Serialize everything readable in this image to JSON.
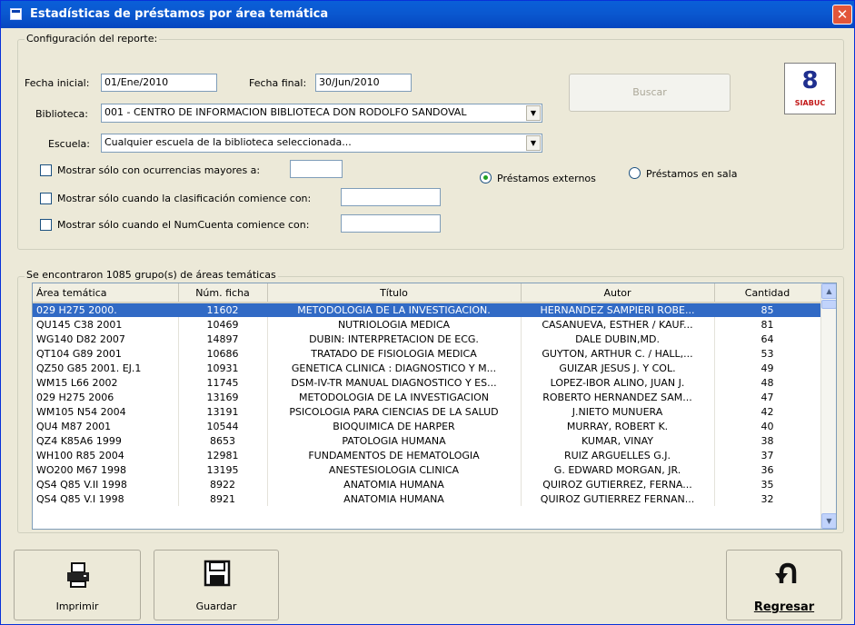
{
  "window": {
    "title": "Estadísticas de préstamos por área temática",
    "close_glyph": "✕"
  },
  "config": {
    "legend": "Configuración del reporte:",
    "fecha_inicial_label": "Fecha inicial:",
    "fecha_inicial_value": "01/Ene/2010",
    "fecha_final_label": "Fecha final:",
    "fecha_final_value": "30/Jun/2010",
    "biblioteca_label": "Biblioteca:",
    "biblioteca_value": "001 - CENTRO DE INFORMACION BIBLIOTECA DON RODOLFO SANDOVAL",
    "escuela_label": "Escuela:",
    "escuela_value": "Cualquier escuela de la biblioteca seleccionada...",
    "chk_ocurrencias_label": "Mostrar sólo con ocurrencias mayores a:",
    "chk_clasificacion_label": "Mostrar sólo cuando la clasificación comience con:",
    "chk_numcuenta_label": "Mostrar sólo cuando el NumCuenta comience con:",
    "radio_externos_label": "Préstamos externos",
    "radio_sala_label": "Préstamos en sala",
    "buscar_label": "Buscar",
    "logo_number": "8",
    "logo_text": "SIABUC"
  },
  "results": {
    "legend": "Se encontraron 1085 grupo(s) de áreas temáticas",
    "columns": [
      "Área temática",
      "Núm. ficha",
      "Título",
      "Autor",
      "Cantidad"
    ],
    "rows": [
      [
        "029 H275 2000.",
        "11602",
        "METODOLOGIA DE LA INVESTIGACION.",
        "HERNANDEZ SAMPIERI ROBE...",
        "85"
      ],
      [
        "QU145 C38 2001",
        "10469",
        "NUTRIOLOGIA MEDICA",
        "CASANUEVA, ESTHER / KAUF...",
        "81"
      ],
      [
        "WG140 D82 2007",
        "14897",
        "DUBIN: INTERPRETACION DE ECG.",
        "DALE DUBIN,MD.",
        "64"
      ],
      [
        "QT104 G89 2001",
        "10686",
        "TRATADO DE FISIOLOGIA MEDICA",
        "GUYTON, ARTHUR C. / HALL,...",
        "53"
      ],
      [
        "QZ50 G85 2001. EJ.1",
        "10931",
        "GENETICA CLINICA : DIAGNOSTICO Y M...",
        "GUIZAR JESUS J. Y COL.",
        "49"
      ],
      [
        "WM15 L66 2002",
        "11745",
        "DSM-IV-TR MANUAL DIAGNOSTICO Y ES...",
        "LOPEZ-IBOR ALINO, JUAN J.",
        "48"
      ],
      [
        "029 H275 2006",
        "13169",
        "METODOLOGIA DE LA INVESTIGACION",
        "ROBERTO  HERNANDEZ SAM...",
        "47"
      ],
      [
        "WM105 N54 2004",
        "13191",
        "PSICOLOGIA PARA CIENCIAS DE LA SALUD",
        "J.NIETO  MUNUERA",
        "42"
      ],
      [
        "QU4 M87 2001",
        "10544",
        "BIOQUIMICA DE HARPER",
        "MURRAY, ROBERT K.",
        "40"
      ],
      [
        "QZ4 K85A6 1999",
        "8653",
        "PATOLOGIA HUMANA",
        "KUMAR, VINAY",
        "38"
      ],
      [
        "WH100 R85 2004",
        "12981",
        "FUNDAMENTOS DE HEMATOLOGIA",
        "RUIZ ARGUELLES  G.J.",
        "37"
      ],
      [
        "WO200 M67 1998",
        "13195",
        "ANESTESIOLOGIA CLINICA",
        "G. EDWARD MORGAN, JR.",
        "36"
      ],
      [
        "QS4 Q85 V.II 1998",
        "8922",
        "ANATOMIA HUMANA",
        "QUIROZ GUTIERREZ, FERNA...",
        "35"
      ],
      [
        "QS4 Q85 V.I 1998",
        "8921",
        "ANATOMIA HUMANA",
        "QUIROZ GUTIERREZ FERNAN...",
        "32"
      ]
    ]
  },
  "actions": {
    "imprimir_label": "Imprimir",
    "guardar_label": "Guardar",
    "regresar_label": "Regresar",
    "imprimir_icon": "printer-icon",
    "guardar_icon": "floppy-disk-icon",
    "regresar_icon": "return-arrow-icon"
  }
}
